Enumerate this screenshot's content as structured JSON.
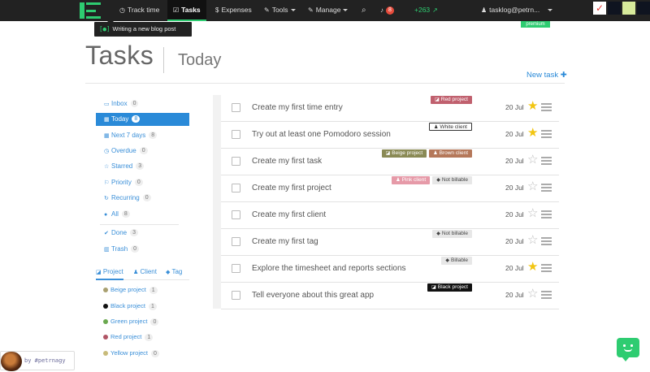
{
  "nav": {
    "track_time": "Track time",
    "tasks": "Tasks",
    "expenses": "Expenses",
    "tools": "Tools",
    "manage": "Manage",
    "notifications": "8",
    "score": "+263",
    "account": "tasklog@petrn..."
  },
  "timer_tooltip": {
    "icon": "[●]",
    "text": "Writing a new blog post"
  },
  "premium": "premium",
  "header": {
    "title": "Tasks",
    "subtitle": "Today",
    "new_task": "New task"
  },
  "sidebar": {
    "items": [
      {
        "label": "Inbox",
        "count": "0",
        "icon": "inbox-icon"
      },
      {
        "label": "Today",
        "count": "8",
        "icon": "calendar-icon"
      },
      {
        "label": "Next 7 days",
        "count": "8",
        "icon": "calendar-week-icon"
      },
      {
        "label": "Overdue",
        "count": "0",
        "icon": "clock-icon"
      },
      {
        "label": "Starred",
        "count": "3",
        "icon": "star-icon"
      },
      {
        "label": "Priority",
        "count": "0",
        "icon": "flag-icon"
      },
      {
        "label": "Recurring",
        "count": "0",
        "icon": "repeat-icon"
      },
      {
        "label": "All",
        "count": "8",
        "icon": "globe-icon"
      },
      {
        "label": "Done",
        "count": "3",
        "icon": "check-icon"
      },
      {
        "label": "Trash",
        "count": "0",
        "icon": "trash-icon"
      }
    ],
    "filter_tabs": [
      "Project",
      "Client",
      "Tag"
    ],
    "projects": [
      {
        "name": "Beige project",
        "count": "1",
        "color": "#a9a070"
      },
      {
        "name": "Black project",
        "count": "1",
        "color": "#111111"
      },
      {
        "name": "Green project",
        "count": "0",
        "color": "#6aa84f"
      },
      {
        "name": "Red project",
        "count": "1",
        "color": "#b05565"
      },
      {
        "name": "Yellow project",
        "count": "0",
        "color": "#c8bb7a"
      }
    ]
  },
  "tasks": [
    {
      "title": "Create my first time entry",
      "date": "20 Jul",
      "starred": true,
      "tags": [
        {
          "label": "Red project",
          "icon": "folder-icon",
          "bg": "#c0606e",
          "fg": "#fff"
        }
      ]
    },
    {
      "title": "Try out at least one Pomodoro session",
      "date": "20 Jul",
      "starred": true,
      "tags": [
        {
          "label": "White client",
          "icon": "user-icon",
          "bg": "#ffffff",
          "fg": "#333",
          "border": "#333"
        }
      ]
    },
    {
      "title": "Create my first task",
      "date": "20 Jul",
      "starred": false,
      "tags": [
        {
          "label": "Beige project",
          "icon": "folder-icon",
          "bg": "#8a8a55",
          "fg": "#fff"
        },
        {
          "label": "Brown client",
          "icon": "user-icon",
          "bg": "#b5785a",
          "fg": "#fff"
        }
      ]
    },
    {
      "title": "Create my first project",
      "date": "20 Jul",
      "starred": false,
      "tags": [
        {
          "label": "Pink client",
          "icon": "user-icon",
          "bg": "#e69aa8",
          "fg": "#fff"
        },
        {
          "label": "Not billable",
          "icon": "tag-icon",
          "bg": "#e7e7e7",
          "fg": "#444"
        }
      ]
    },
    {
      "title": "Create my first client",
      "date": "20 Jul",
      "starred": false,
      "tags": []
    },
    {
      "title": "Create my first tag",
      "date": "20 Jul",
      "starred": false,
      "tags": [
        {
          "label": "Not billable",
          "icon": "tag-icon",
          "bg": "#e7e7e7",
          "fg": "#444"
        }
      ]
    },
    {
      "title": "Explore the timesheet and reports sections",
      "date": "20 Jul",
      "starred": true,
      "tags": [
        {
          "label": "Billable",
          "icon": "tag-icon",
          "bg": "#e7e7e7",
          "fg": "#444"
        }
      ]
    },
    {
      "title": "Tell everyone about this great app",
      "date": "20 Jul",
      "starred": false,
      "tags": [
        {
          "label": "Black project",
          "icon": "folder-icon",
          "bg": "#111111",
          "fg": "#fff"
        }
      ]
    }
  ],
  "footer": {
    "credit": "by #petrnagy"
  },
  "colors": {
    "accent": "#2ecc71",
    "link": "#2a8ad8",
    "navbar": "#222222",
    "star_on": "#f2c511"
  }
}
